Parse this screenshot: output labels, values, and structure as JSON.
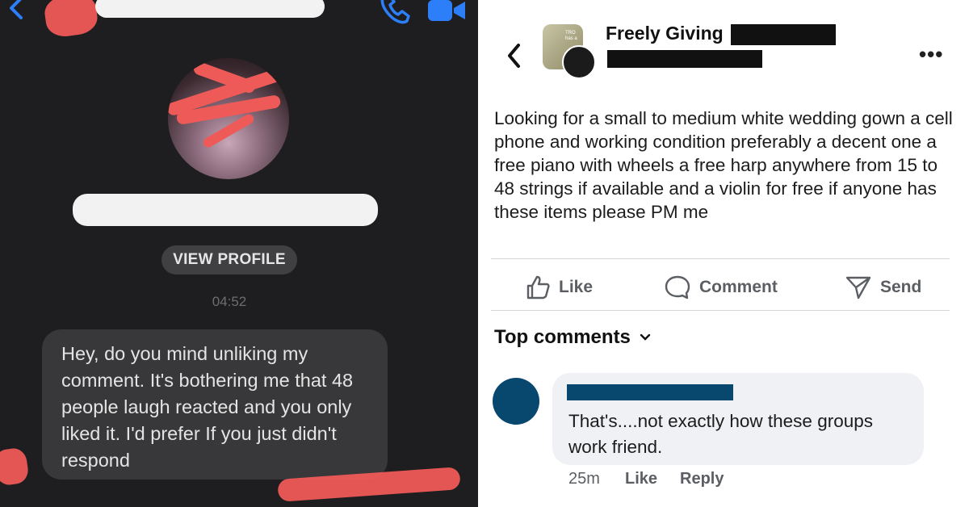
{
  "left": {
    "view_profile_label": "VIEW PROFILE",
    "timestamp": "04:52",
    "message": "Hey, do you mind unliking my comment. It's bothering me that 48 people laugh reacted and you only liked it. I'd prefer If you just didn't respond",
    "accent": "#2d7ff9",
    "redact_red": "#ee5a57"
  },
  "right": {
    "group_name": "Freely Giving",
    "post_text": "Looking for a small to medium white wedding gown a cell phone and working condition preferably a decent one a free piano with wheels a free harp anywhere from 15 to 48 strings if available and a violin for free if anyone has these items please PM me",
    "actions": {
      "like": "Like",
      "comment": "Comment",
      "send": "Send"
    },
    "top_comments_label": "Top comments",
    "comment": {
      "text": "That's....not exactly how these groups work friend.",
      "time": "25m",
      "like_label": "Like",
      "reply_label": "Reply"
    },
    "avatar_color": "#08476e"
  },
  "icons": [
    "back-chevron-icon",
    "phone-icon",
    "video-icon",
    "more-icon",
    "like-thumb-icon",
    "comment-icon",
    "send-icon",
    "chevron-down-icon"
  ]
}
